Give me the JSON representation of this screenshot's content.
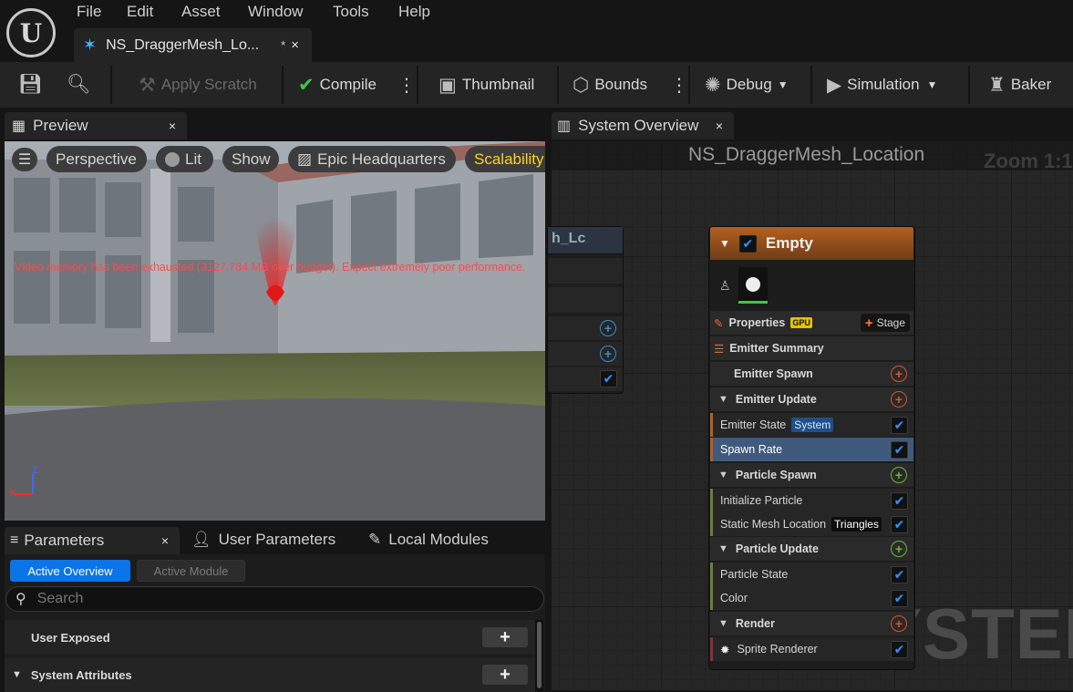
{
  "menu": {
    "items": [
      "File",
      "Edit",
      "Asset",
      "Window",
      "Tools",
      "Help"
    ]
  },
  "logo": {
    "glyph": "U"
  },
  "doc_tab": {
    "title": "NS_DraggerMesh_Lo...",
    "modified": "*",
    "close": "×",
    "icon": "niagara-system-icon"
  },
  "toolbar": {
    "apply_scratch": "Apply Scratch",
    "compile": "Compile",
    "thumbnail": "Thumbnail",
    "bounds": "Bounds",
    "debug": "Debug",
    "simulation": "Simulation",
    "baker": "Baker"
  },
  "preview": {
    "tab": "Preview",
    "close": "×",
    "viewport": {
      "perspective": "Perspective",
      "lit": "Lit",
      "show": "Show",
      "headquarters": "Epic Headquarters",
      "scalability": "Scalability",
      "warning": "Video memory has been exhausted (3127.784 MB over budget). Expect extremely poor performance.",
      "axis": {
        "z": "Z",
        "x": "X"
      }
    }
  },
  "params": {
    "tab": "Parameters",
    "close": "×",
    "user_tab": "User Parameters",
    "local_tab": "Local Modules",
    "active_overview": "Active Overview",
    "active_module": "Active Module",
    "search_placeholder": "Search",
    "rows": [
      {
        "label": "User Exposed",
        "add": "+"
      },
      {
        "label": "System Attributes",
        "add": "+"
      }
    ]
  },
  "overview": {
    "tab": "System Overview",
    "close": "×",
    "title": "NS_DraggerMesh_Location",
    "zoom": "Zoom 1:1",
    "watermark": "SYSTEM",
    "left_node": {
      "title": "h_Lc"
    },
    "emitter": {
      "name": "Empty",
      "properties": "Properties",
      "gpu": "GPU",
      "stage": "Stage",
      "summary": "Emitter Summary",
      "emitter_spawn": "Emitter Spawn",
      "emitter_update": "Emitter Update",
      "emitter_state": "Emitter State",
      "emitter_state_tag": "System",
      "spawn_rate": "Spawn Rate",
      "particle_spawn": "Particle Spawn",
      "initialize_particle": "Initialize Particle",
      "static_mesh_location": "Static Mesh Location",
      "static_mesh_tag": "Triangles",
      "particle_update": "Particle Update",
      "particle_state": "Particle State",
      "color": "Color",
      "render": "Render",
      "sprite_renderer": "Sprite Renderer"
    }
  },
  "colors": {
    "accent_blue": "#2f95ff",
    "emitter_header": "#b4601f",
    "scalability": "#ffd21e",
    "warning": "#ff4a4a",
    "gpu_badge": "#e4c400"
  }
}
